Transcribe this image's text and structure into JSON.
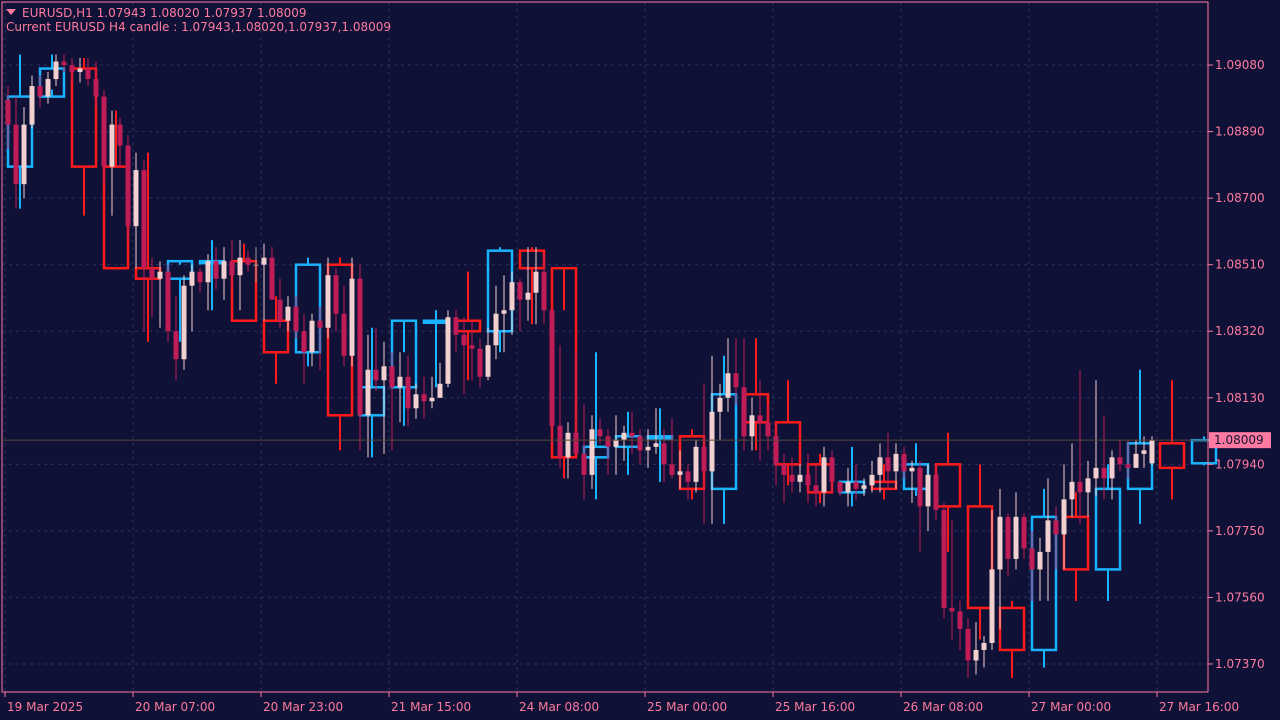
{
  "chart": {
    "symbol_line": "EURUSD,H1  1.07943 1.08020 1.07937 1.08009",
    "info_line": "Current EURUSD H4 candle : 1.07943,1.08020,1.07937,1.08009",
    "current_price_label": "1.08009",
    "current_price": 1.08009,
    "colors": {
      "background": "#0f1236",
      "axis_text": "#ff7aa0",
      "grid": "#2b3160",
      "h4_bull": "#19b4ff",
      "h4_bear": "#ff1a1a",
      "h1_bull": "#f2d0d0",
      "h1_bear": "#c01c58",
      "h1_doji": "#9a9a9a",
      "price_label_bg": "#ff7aa0",
      "price_label_text": "#0f1236"
    }
  },
  "chart_data": {
    "type": "candlestick",
    "symbol": "EURUSD",
    "timeframe": "H1",
    "overlay_timeframe": "H4",
    "y_ticks": [
      "1.09080",
      "1.08890",
      "1.08700",
      "1.08510",
      "1.08320",
      "1.08130",
      "1.07940",
      "1.07750",
      "1.07560",
      "1.07370"
    ],
    "y_tick_values": [
      1.0908,
      1.0889,
      1.087,
      1.0851,
      1.0832,
      1.0813,
      1.0794,
      1.0775,
      1.0756,
      1.0737
    ],
    "ylim": [
      1.0729,
      1.0926
    ],
    "x_ticks": [
      "19 Mar 2025",
      "20 Mar 07:00",
      "20 Mar 23:00",
      "21 Mar 15:00",
      "24 Mar 08:00",
      "25 Mar 00:00",
      "25 Mar 16:00",
      "26 Mar 08:00",
      "27 Mar 00:00",
      "27 Mar 16:00"
    ],
    "x_tick_bars": [
      0,
      16,
      32,
      48,
      64,
      80,
      96,
      112,
      128,
      144
    ],
    "h1_candles": [
      [
        1.0898,
        1.0902,
        1.0884,
        1.0891
      ],
      [
        1.0891,
        1.0899,
        1.0867,
        1.0874
      ],
      [
        1.0874,
        1.0896,
        1.087,
        1.0891
      ],
      [
        1.0891,
        1.0905,
        1.089,
        1.0902
      ],
      [
        1.0902,
        1.0905,
        1.0896,
        1.0899
      ],
      [
        1.0899,
        1.0906,
        1.0897,
        1.0904
      ],
      [
        1.0904,
        1.0911,
        1.0902,
        1.0909
      ],
      [
        1.0909,
        1.0911,
        1.0906,
        1.0908
      ],
      [
        1.0908,
        1.091,
        1.0903,
        1.0906
      ],
      [
        1.0906,
        1.091,
        1.0903,
        1.0907
      ],
      [
        1.0907,
        1.091,
        1.0902,
        1.0904
      ],
      [
        1.0904,
        1.0909,
        1.0896,
        1.0899
      ],
      [
        1.0899,
        1.0901,
        1.0874,
        1.0879
      ],
      [
        1.0879,
        1.0895,
        1.0865,
        1.0891
      ],
      [
        1.0891,
        1.0893,
        1.0879,
        1.0885
      ],
      [
        1.0885,
        1.0888,
        1.0858,
        1.0862
      ],
      [
        1.0862,
        1.0883,
        1.085,
        1.0878
      ],
      [
        1.0878,
        1.0881,
        1.0832,
        1.085
      ],
      [
        1.085,
        1.0853,
        1.0836,
        1.0847
      ],
      [
        1.0847,
        1.0852,
        1.0833,
        1.0849
      ],
      [
        1.0849,
        1.0851,
        1.0829,
        1.0832
      ],
      [
        1.0832,
        1.0842,
        1.0818,
        1.0824
      ],
      [
        1.0824,
        1.0848,
        1.0821,
        1.0845
      ],
      [
        1.0845,
        1.0851,
        1.0832,
        1.0849
      ],
      [
        1.0849,
        1.085,
        1.0843,
        1.0846
      ],
      [
        1.0846,
        1.0854,
        1.0838,
        1.0852
      ],
      [
        1.0852,
        1.0856,
        1.0844,
        1.0847
      ],
      [
        1.0847,
        1.0856,
        1.0841,
        1.0852
      ],
      [
        1.0852,
        1.0858,
        1.0845,
        1.0848
      ],
      [
        1.0848,
        1.0858,
        1.0838,
        1.0853
      ],
      [
        1.0853,
        1.0855,
        1.0849,
        1.0851
      ],
      [
        1.0851,
        1.0856,
        1.0846,
        1.0851
      ],
      [
        1.0851,
        1.0857,
        1.0835,
        1.0853
      ],
      [
        1.0853,
        1.0856,
        1.0843,
        1.0841
      ],
      [
        1.0841,
        1.0847,
        1.0833,
        1.0835
      ],
      [
        1.0835,
        1.0842,
        1.0832,
        1.0839
      ],
      [
        1.0839,
        1.0842,
        1.083,
        1.0832
      ],
      [
        1.0832,
        1.0837,
        1.0817,
        1.0826
      ],
      [
        1.0826,
        1.0837,
        1.0822,
        1.0835
      ],
      [
        1.0835,
        1.0839,
        1.0821,
        1.0833
      ],
      [
        1.0833,
        1.0853,
        1.083,
        1.0848
      ],
      [
        1.0848,
        1.085,
        1.0832,
        1.0837
      ],
      [
        1.0837,
        1.0845,
        1.0822,
        1.0825
      ],
      [
        1.0825,
        1.0853,
        1.0822,
        1.0847
      ],
      [
        1.0847,
        1.0851,
        1.0798,
        1.0808
      ],
      [
        1.0808,
        1.0831,
        1.0796,
        1.0821
      ],
      [
        1.0821,
        1.0833,
        1.0815,
        1.0818
      ],
      [
        1.0818,
        1.0829,
        1.0797,
        1.0822
      ],
      [
        1.0822,
        1.0826,
        1.0798,
        1.0816
      ],
      [
        1.0816,
        1.0826,
        1.0806,
        1.0819
      ],
      [
        1.0819,
        1.0825,
        1.0805,
        1.081
      ],
      [
        1.081,
        1.0817,
        1.0807,
        1.0814
      ],
      [
        1.0814,
        1.0819,
        1.0807,
        1.0812
      ],
      [
        1.0812,
        1.0819,
        1.081,
        1.0813
      ],
      [
        1.0813,
        1.0823,
        1.0813,
        1.0817
      ],
      [
        1.0817,
        1.0838,
        1.0816,
        1.0836
      ],
      [
        1.0836,
        1.0838,
        1.0826,
        1.0831
      ],
      [
        1.0831,
        1.0836,
        1.0814,
        1.0828
      ],
      [
        1.0828,
        1.0835,
        1.0818,
        1.0827
      ],
      [
        1.0827,
        1.083,
        1.0816,
        1.0819
      ],
      [
        1.0819,
        1.0833,
        1.0818,
        1.0828
      ],
      [
        1.0828,
        1.0845,
        1.0824,
        1.0837
      ],
      [
        1.0837,
        1.0848,
        1.0826,
        1.0838
      ],
      [
        1.0838,
        1.0849,
        1.0831,
        1.0846
      ],
      [
        1.0846,
        1.0847,
        1.0832,
        1.0841
      ],
      [
        1.0841,
        1.0856,
        1.0835,
        1.0843
      ],
      [
        1.0843,
        1.0856,
        1.0834,
        1.0849
      ],
      [
        1.0849,
        1.0854,
        1.0834,
        1.0838
      ],
      [
        1.0838,
        1.0838,
        1.08,
        1.0805
      ],
      [
        1.0805,
        1.0828,
        1.0793,
        1.0796
      ],
      [
        1.0796,
        1.0806,
        1.079,
        1.0803
      ],
      [
        1.0803,
        1.0826,
        1.0797,
        1.0797
      ],
      [
        1.0797,
        1.0811,
        1.0784,
        1.0791
      ],
      [
        1.0791,
        1.0808,
        1.0787,
        1.0804
      ],
      [
        1.0804,
        1.0807,
        1.08,
        1.0802
      ],
      [
        1.0802,
        1.0804,
        1.0791,
        1.0799
      ],
      [
        1.0799,
        1.0808,
        1.0791,
        1.0801
      ],
      [
        1.0801,
        1.0805,
        1.0795,
        1.0803
      ],
      [
        1.0803,
        1.0809,
        1.0797,
        1.0802
      ],
      [
        1.0802,
        1.0804,
        1.0794,
        1.0798
      ],
      [
        1.0798,
        1.0804,
        1.0793,
        1.0799
      ],
      [
        1.0799,
        1.081,
        1.0797,
        1.08
      ],
      [
        1.08,
        1.0804,
        1.0789,
        1.0794
      ],
      [
        1.0794,
        1.0807,
        1.079,
        1.0791
      ],
      [
        1.0791,
        1.0798,
        1.0787,
        1.0792
      ],
      [
        1.0792,
        1.0794,
        1.0784,
        1.0789
      ],
      [
        1.0789,
        1.0801,
        1.0786,
        1.0799
      ],
      [
        1.0799,
        1.0817,
        1.0777,
        1.0792
      ],
      [
        1.0792,
        1.0825,
        1.0777,
        1.0809
      ],
      [
        1.0809,
        1.0817,
        1.0801,
        1.0813
      ],
      [
        1.0813,
        1.083,
        1.0809,
        1.082
      ],
      [
        1.082,
        1.083,
        1.0811,
        1.0816
      ],
      [
        1.0816,
        1.083,
        1.0798,
        1.0802
      ],
      [
        1.0802,
        1.0813,
        1.0798,
        1.0808
      ],
      [
        1.0808,
        1.0818,
        1.0795,
        1.0806
      ],
      [
        1.0806,
        1.0811,
        1.0798,
        1.0802
      ],
      [
        1.0802,
        1.0805,
        1.0788,
        1.0794
      ],
      [
        1.0794,
        1.0797,
        1.0783,
        1.0791
      ],
      [
        1.0791,
        1.0796,
        1.0786,
        1.0789
      ],
      [
        1.0789,
        1.0794,
        1.0786,
        1.0791
      ],
      [
        1.0791,
        1.0797,
        1.0783,
        1.0788
      ],
      [
        1.0788,
        1.0794,
        1.0782,
        1.0786
      ],
      [
        1.0786,
        1.0799,
        1.0782,
        1.0796
      ],
      [
        1.0796,
        1.0798,
        1.0786,
        1.0789
      ],
      [
        1.0789,
        1.0789,
        1.0785,
        1.0786
      ],
      [
        1.0786,
        1.0793,
        1.0782,
        1.0789
      ],
      [
        1.0789,
        1.0794,
        1.0784,
        1.0787
      ],
      [
        1.0787,
        1.079,
        1.0785,
        1.0788
      ],
      [
        1.0788,
        1.0795,
        1.0786,
        1.0791
      ],
      [
        1.0791,
        1.08,
        1.0786,
        1.0796
      ],
      [
        1.0796,
        1.0803,
        1.0787,
        1.0792
      ],
      [
        1.0792,
        1.08,
        1.0787,
        1.0797
      ],
      [
        1.0797,
        1.0799,
        1.079,
        1.0792
      ],
      [
        1.0792,
        1.0795,
        1.0783,
        1.0793
      ],
      [
        1.0793,
        1.0795,
        1.0769,
        1.0782
      ],
      [
        1.0782,
        1.0794,
        1.0775,
        1.0791
      ],
      [
        1.0791,
        1.0794,
        1.0778,
        1.0781
      ],
      [
        1.0781,
        1.0783,
        1.075,
        1.0753
      ],
      [
        1.0753,
        1.0778,
        1.0744,
        1.0752
      ],
      [
        1.0752,
        1.0755,
        1.0741,
        1.0747
      ],
      [
        1.0747,
        1.075,
        1.0733,
        1.0738
      ],
      [
        1.0738,
        1.0749,
        1.0734,
        1.0741
      ],
      [
        1.0741,
        1.0745,
        1.0736,
        1.0743
      ],
      [
        1.0743,
        1.0781,
        1.0741,
        1.0764
      ],
      [
        1.0764,
        1.0787,
        1.0747,
        1.0779
      ],
      [
        1.0779,
        1.078,
        1.0762,
        1.0767
      ],
      [
        1.0767,
        1.0786,
        1.0764,
        1.0779
      ],
      [
        1.0779,
        1.078,
        1.0767,
        1.077
      ],
      [
        1.077,
        1.0775,
        1.0755,
        1.0764
      ],
      [
        1.0764,
        1.0773,
        1.0755,
        1.0769
      ],
      [
        1.0769,
        1.079,
        1.0755,
        1.0778
      ],
      [
        1.0778,
        1.0782,
        1.0764,
        1.0774
      ],
      [
        1.0774,
        1.0794,
        1.0764,
        1.0784
      ],
      [
        1.0784,
        1.08,
        1.0779,
        1.0789
      ],
      [
        1.0789,
        1.0821,
        1.0777,
        1.0786
      ],
      [
        1.0786,
        1.0795,
        1.0779,
        1.079
      ],
      [
        1.079,
        1.0818,
        1.0785,
        1.0793
      ],
      [
        1.0793,
        1.0808,
        1.0784,
        1.079
      ],
      [
        1.079,
        1.0798,
        1.0784,
        1.0796
      ],
      [
        1.0796,
        1.0801,
        1.0792,
        1.0794
      ],
      [
        1.0794,
        1.0801,
        1.079,
        1.0793
      ],
      [
        1.0793,
        1.0801,
        1.0793,
        1.0797
      ],
      [
        1.0797,
        1.0802,
        1.0793,
        1.0798
      ],
      [
        1.07943,
        1.0802,
        1.07937,
        1.08009
      ]
    ],
    "h4_candles": [
      [
        1.0879,
        1.0911,
        1.0867,
        1.0899
      ],
      [
        1.0899,
        1.0911,
        1.0901,
        1.0907
      ],
      [
        1.0907,
        1.091,
        1.0865,
        1.0879
      ],
      [
        1.0879,
        1.0895,
        1.085,
        1.085
      ],
      [
        1.085,
        1.0883,
        1.0829,
        1.0847
      ],
      [
        1.0847,
        1.0851,
        1.0829,
        1.0852
      ],
      [
        1.0852,
        1.0858,
        1.0838,
        1.0852
      ],
      [
        1.0852,
        1.0857,
        1.0835,
        1.0835
      ],
      [
        1.0835,
        1.0842,
        1.0817,
        1.0826
      ],
      [
        1.0826,
        1.0853,
        1.0822,
        1.0851
      ],
      [
        1.0851,
        1.0853,
        1.0798,
        1.0808
      ],
      [
        1.0808,
        1.0833,
        1.0796,
        1.0816
      ],
      [
        1.0816,
        1.0826,
        1.0805,
        1.0835
      ],
      [
        1.0835,
        1.0838,
        1.0816,
        1.0835
      ],
      [
        1.0835,
        1.0849,
        1.0818,
        1.0832
      ],
      [
        1.0832,
        1.0856,
        1.0826,
        1.0855
      ],
      [
        1.0855,
        1.0856,
        1.0834,
        1.085
      ],
      [
        1.085,
        1.0838,
        1.079,
        1.0796
      ],
      [
        1.0796,
        1.0826,
        1.0784,
        1.0799
      ],
      [
        1.0799,
        1.0809,
        1.0791,
        1.0802
      ],
      [
        1.0802,
        1.081,
        1.0789,
        1.0802
      ],
      [
        1.0802,
        1.0804,
        1.0784,
        1.0787
      ],
      [
        1.0787,
        1.0825,
        1.0777,
        1.0814
      ],
      [
        1.0814,
        1.083,
        1.0798,
        1.0806
      ],
      [
        1.0806,
        1.0818,
        1.0788,
        1.0794
      ],
      [
        1.0794,
        1.0797,
        1.0783,
        1.0786
      ],
      [
        1.0786,
        1.0799,
        1.0782,
        1.0789
      ],
      [
        1.0789,
        1.0794,
        1.0784,
        1.0787
      ],
      [
        1.0787,
        1.08,
        1.0785,
        1.0794
      ],
      [
        1.0794,
        1.0803,
        1.0769,
        1.0782
      ],
      [
        1.0782,
        1.0794,
        1.0744,
        1.0753
      ],
      [
        1.0753,
        1.0755,
        1.0733,
        1.0741
      ],
      [
        1.0741,
        1.0787,
        1.0736,
        1.0779
      ],
      [
        1.0779,
        1.0786,
        1.0755,
        1.0764
      ],
      [
        1.0764,
        1.0794,
        1.0755,
        1.0787
      ],
      [
        1.0787,
        1.0821,
        1.0777,
        1.08
      ],
      [
        1.08,
        1.0818,
        1.0784,
        1.0793
      ],
      [
        1.07943,
        1.0802,
        1.07937,
        1.08009
      ]
    ]
  }
}
